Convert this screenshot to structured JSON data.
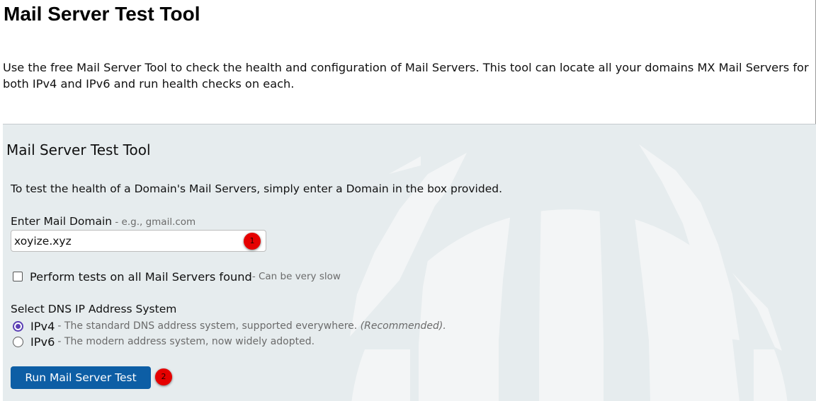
{
  "page": {
    "title": "Mail Server Test Tool",
    "intro": "Use the free Mail Server Tool to check the health and configuration of Mail Servers. This tool can locate all your domains MX Mail Servers for both IPv4 and IPv6 and run health checks on each."
  },
  "panel": {
    "title": "Mail Server Test Tool",
    "description": "To test the health of a Domain's Mail Servers, simply enter a Domain in the box provided.",
    "domain_label": "Enter Mail Domain",
    "domain_hint": " - e.g., gmail.com",
    "domain_value": "xoyize.xyz",
    "checkbox_label": "Perform tests on all Mail Servers found",
    "checkbox_hint": " - Can be very slow",
    "checkbox_checked": false,
    "dns_label": "Select DNS IP Address System",
    "options": [
      {
        "label": "IPv4",
        "desc": "- The standard DNS address system, supported everywhere.",
        "desc_em": "(Recommended).",
        "checked": true
      },
      {
        "label": "IPv6",
        "desc": "- The modern address system, now widely adopted.",
        "checked": false
      }
    ],
    "run_label": "Run Mail Server Test",
    "background_icon": "globe-icon"
  },
  "markers": [
    "1",
    "2"
  ],
  "colors": {
    "panel_bg": "#e6ecee",
    "button_bg": "#0d5ea5",
    "radio_accent": "#5b3fb4",
    "marker_bg": "#e50000"
  }
}
